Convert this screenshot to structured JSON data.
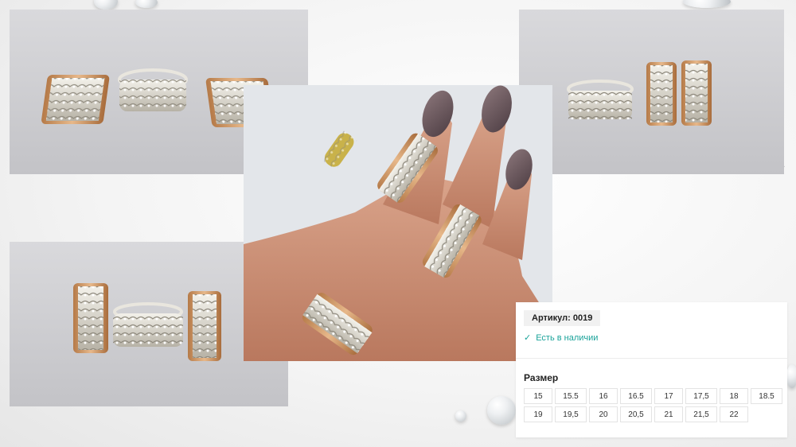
{
  "product": {
    "sku_label": "Артикул: 0019",
    "availability": "Есть в наличии",
    "check_icon": "check-icon",
    "accent_color": "#1aa39a"
  },
  "sizes": {
    "title": "Размер",
    "options": [
      "15",
      "15.5",
      "16",
      "16.5",
      "17",
      "17,5",
      "18",
      "18.5",
      "19",
      "19,5",
      "20",
      "20,5",
      "21",
      "21,5",
      "22"
    ]
  },
  "gallery": {
    "images": [
      "earrings-and-ring-set",
      "ring-on-hand",
      "ring-and-earrings-set-right",
      "earrings-ring-set-lower-left"
    ]
  }
}
